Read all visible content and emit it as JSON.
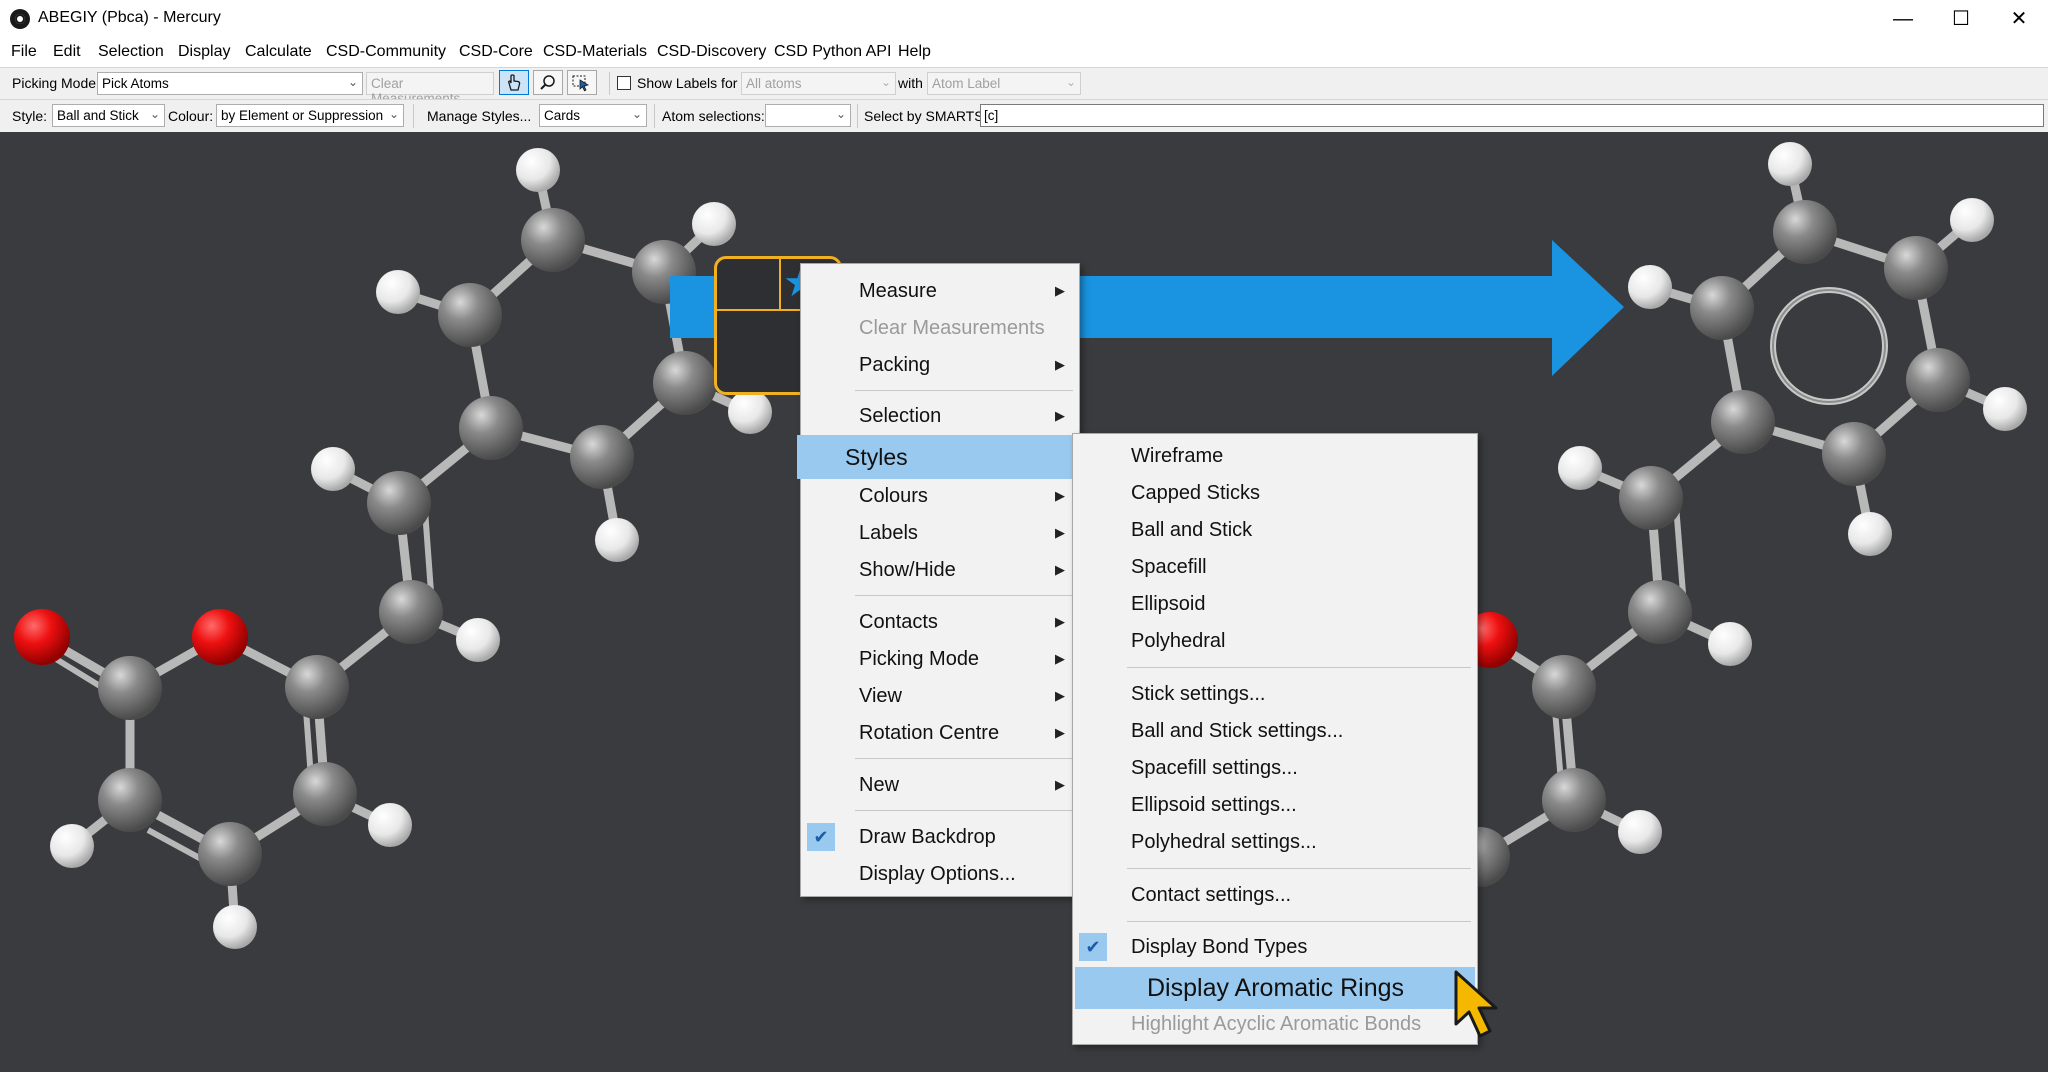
{
  "window": {
    "title": "ABEGIY (Pbca) - Mercury"
  },
  "menubar": [
    "File",
    "Edit",
    "Selection",
    "Display",
    "Calculate",
    "CSD-Community",
    "CSD-Core",
    "CSD-Materials",
    "CSD-Discovery",
    "CSD Python API",
    "Help"
  ],
  "toolbar1": {
    "picking_mode_label": "Picking Mode:",
    "picking_mode_value": "Pick Atoms",
    "clear_measurements": "Clear Measurements",
    "show_labels_label": "Show Labels for",
    "show_labels_value": "All atoms",
    "with_label": "with",
    "with_value": "Atom Label"
  },
  "toolbar2": {
    "style_label": "Style:",
    "style_value": "Ball and Stick",
    "colour_label": "Colour:",
    "colour_value": "by Element or Suppression",
    "manage_styles": "Manage Styles...",
    "cards_value": "Cards",
    "atom_selections_label": "Atom selections:",
    "atom_selections_value": "",
    "smarts_label": "Select by SMARTS:",
    "smarts_value": "[c]"
  },
  "context_menu": {
    "items": [
      {
        "label": "Measure"
      },
      {
        "label": "Clear Measurements"
      },
      {
        "label": "Packing"
      },
      {
        "label": "Selection"
      },
      {
        "label": "Styles"
      },
      {
        "label": "Colours"
      },
      {
        "label": "Labels"
      },
      {
        "label": "Show/Hide"
      },
      {
        "label": "Contacts"
      },
      {
        "label": "Picking Mode"
      },
      {
        "label": "View"
      },
      {
        "label": "Rotation Centre"
      },
      {
        "label": "New"
      },
      {
        "label": "Draw Backdrop"
      },
      {
        "label": "Display Options..."
      }
    ]
  },
  "styles_submenu": {
    "items": [
      {
        "label": "Wireframe"
      },
      {
        "label": "Capped Sticks"
      },
      {
        "label": "Ball and Stick"
      },
      {
        "label": "Spacefill"
      },
      {
        "label": "Ellipsoid"
      },
      {
        "label": "Polyhedral"
      },
      {
        "label": "Stick settings..."
      },
      {
        "label": "Ball and Stick settings..."
      },
      {
        "label": "Spacefill settings..."
      },
      {
        "label": "Ellipsoid settings..."
      },
      {
        "label": "Polyhedral settings..."
      },
      {
        "label": "Contact settings..."
      },
      {
        "label": "Display Bond Types"
      },
      {
        "label": "Display Aromatic Rings"
      },
      {
        "label": "Highlight Acyclic Aromatic Bonds"
      }
    ]
  },
  "colors": {
    "accent_blue": "#1a93e0",
    "highlight": "#99c9ef",
    "popup_border": "#f0b020",
    "cursor": "#f5b800"
  }
}
